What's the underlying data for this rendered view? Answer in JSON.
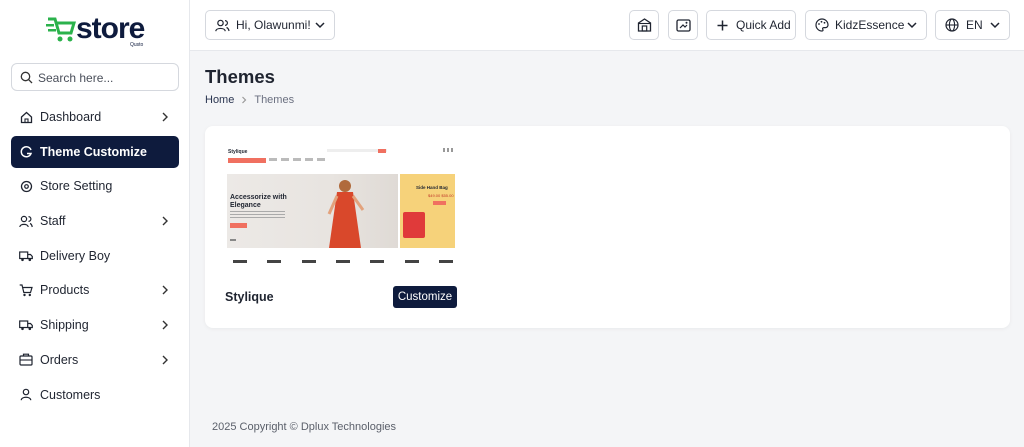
{
  "brand": {
    "name": "store",
    "sub": "Qusto",
    "icon": "cart-icon",
    "accent": "#2bb24c"
  },
  "sidebar": {
    "search_placeholder": "Search here...",
    "items": [
      {
        "label": "Dashboard",
        "icon": "home-icon",
        "has_submenu": true
      },
      {
        "label": "Theme Customize",
        "icon": "theme-icon",
        "has_submenu": false,
        "active": true
      },
      {
        "label": "Store Setting",
        "icon": "store-setting-icon",
        "has_submenu": false
      },
      {
        "label": "Staff",
        "icon": "staff-icon",
        "has_submenu": true
      },
      {
        "label": "Delivery Boy",
        "icon": "truck-icon",
        "has_submenu": false
      },
      {
        "label": "Products",
        "icon": "cart-icon",
        "has_submenu": true
      },
      {
        "label": "Shipping",
        "icon": "shipping-icon",
        "has_submenu": true
      },
      {
        "label": "Orders",
        "icon": "orders-icon",
        "has_submenu": true
      },
      {
        "label": "Customers",
        "icon": "customer-icon",
        "has_submenu": false
      }
    ]
  },
  "topbar": {
    "greeting": "Hi, Olawunmi!",
    "quick_add": "Quick Add",
    "store": "KidzEssence",
    "language": "EN"
  },
  "page": {
    "title": "Themes",
    "breadcrumb": [
      "Home",
      "Themes"
    ]
  },
  "themes": [
    {
      "name": "Stylique",
      "button": "Customize",
      "preview": {
        "brand": "Stylique",
        "hero_title": "Accessorize with Elegance",
        "side_title": "Side Hand Bag",
        "side_price": "$49.00 $55.00"
      }
    }
  ],
  "footer": "2025 Copyright © Dplux Technologies",
  "colors": {
    "primary": "#0e1b3d",
    "accent": "#f07060",
    "bg": "#f4f5f7"
  }
}
